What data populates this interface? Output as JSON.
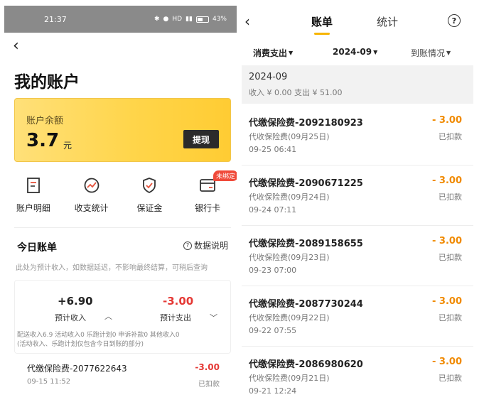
{
  "left": {
    "status_bar": {
      "time": "21:37",
      "network": "HD",
      "battery": "43%"
    },
    "title": "我的账户",
    "balance": {
      "label": "账户余额",
      "amount": "3.7",
      "unit": "元",
      "withdraw_label": "提现"
    },
    "quick_actions": [
      {
        "label": "账户明细",
        "icon": "document-icon"
      },
      {
        "label": "收支统计",
        "icon": "chart-icon"
      },
      {
        "label": "保证金",
        "icon": "shield-check-icon"
      },
      {
        "label": "银行卡",
        "icon": "bank-card-icon",
        "badge": "未绑定"
      }
    ],
    "today": {
      "title": "今日账单",
      "data_note": "数据说明",
      "subtitle": "此处为预计收入，如数据延迟，不影响最终结算，可稍后查询",
      "income_amount": "+6.90",
      "income_label": "预计收入",
      "expense_amount": "-3.00",
      "expense_label": "预计支出",
      "breakdown_line1": "配送收入6.9 活动收入0 乐跑计划0 申诉补款0 其他收入0",
      "breakdown_line2": "(活动收入、乐跑计划仅包含今日到账的部分)",
      "row": {
        "title": "代缴保险费-2077622643",
        "time": "09-15 11:52",
        "amount": "-3.00",
        "status": "已扣款"
      }
    }
  },
  "right": {
    "tabs": [
      {
        "label": "账单",
        "active": true
      },
      {
        "label": "统计",
        "active": false
      }
    ],
    "filters": [
      "消费支出",
      "2024-09",
      "到账情况"
    ],
    "month": {
      "title": "2024-09",
      "summary": "收入 ¥ 0.00 支出 ¥ 51.00"
    },
    "bills": [
      {
        "title": "代缴保险费-2092180923",
        "subtitle": "代收保险费(09月25日)",
        "time": "09-25 06:41",
        "amount": "- 3.00",
        "status": "已扣款"
      },
      {
        "title": "代缴保险费-2090671225",
        "subtitle": "代收保险费(09月24日)",
        "time": "09-24 07:11",
        "amount": "- 3.00",
        "status": "已扣款"
      },
      {
        "title": "代缴保险费-2089158655",
        "subtitle": "代收保险费(09月23日)",
        "time": "09-23 07:00",
        "amount": "- 3.00",
        "status": "已扣款"
      },
      {
        "title": "代缴保险费-2087730244",
        "subtitle": "代收保险费(09月22日)",
        "time": "09-22 07:55",
        "amount": "- 3.00",
        "status": "已扣款"
      },
      {
        "title": "代缴保险费-2086980620",
        "subtitle": "代收保险费(09月21日)",
        "time": "09-21 12:24",
        "amount": "- 3.00",
        "status": "已扣款"
      }
    ]
  },
  "colors": {
    "accent_yellow": "#ffd54a",
    "expense_red": "#e53935",
    "amount_orange": "#f08a00",
    "badge_red": "#f04a3a"
  }
}
